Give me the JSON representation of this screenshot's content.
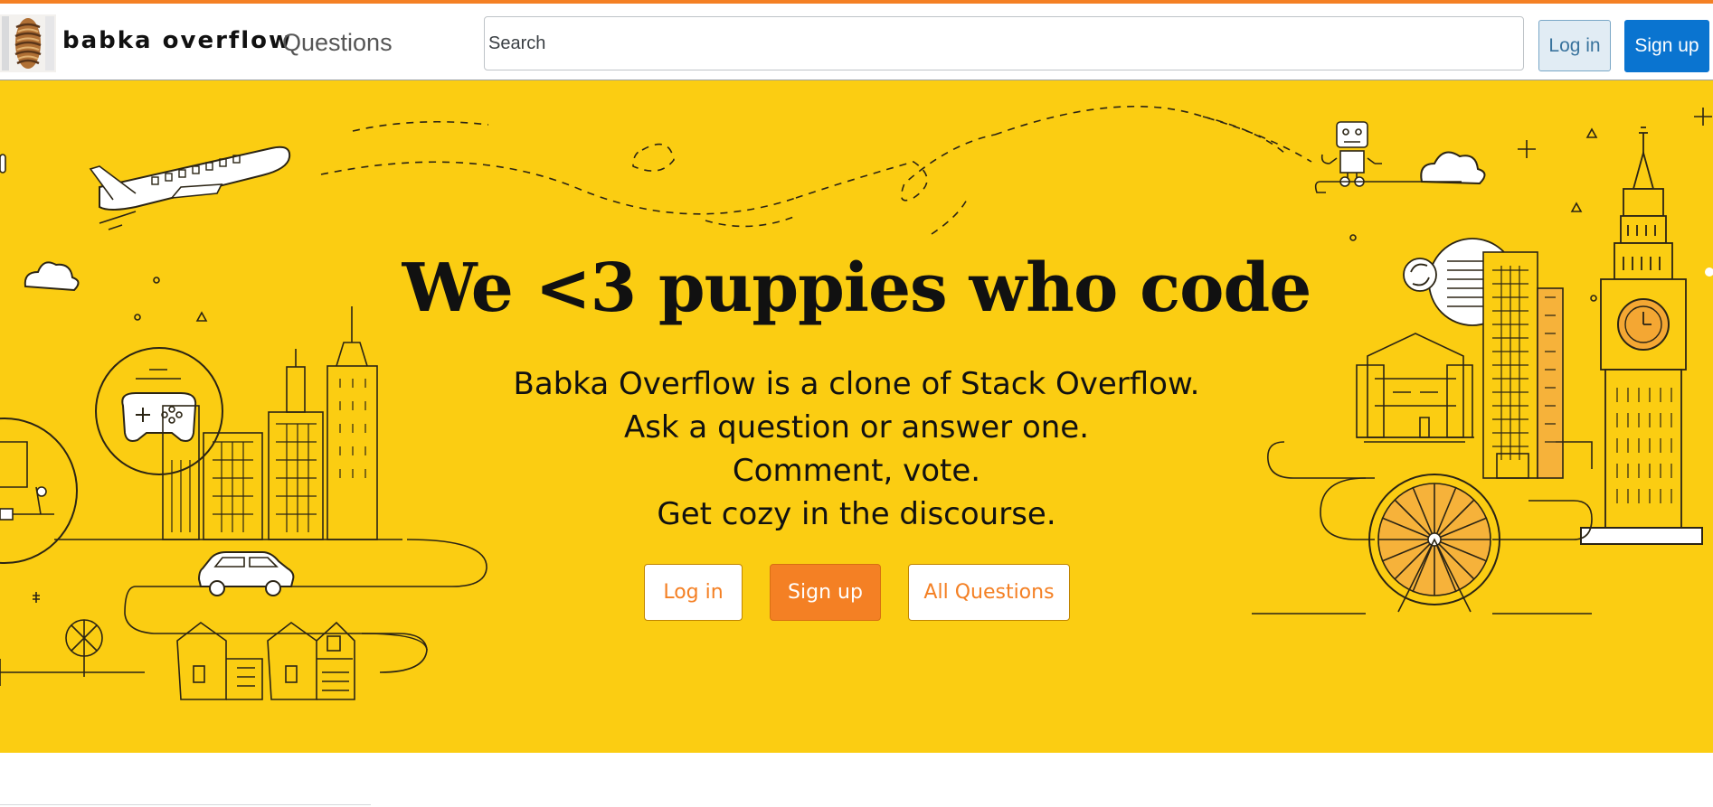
{
  "navbar": {
    "brand": "babka overflow",
    "questions_link": "Questions",
    "search_placeholder": "Search",
    "login_label": "Log in",
    "signup_label": "Sign up"
  },
  "hero": {
    "title": "We <3 puppies who code",
    "lines": [
      "Babka Overflow is a clone of Stack Overflow.",
      "Ask a question or answer one.",
      "Comment, vote.",
      "Get cozy in the discourse."
    ],
    "buttons": {
      "login": "Log in",
      "signup": "Sign up",
      "all_questions": "All Questions"
    }
  },
  "colors": {
    "accent_orange": "#f48024",
    "hero_yellow": "#fbcd12",
    "primary_blue": "#0a74d0",
    "login_bg": "#e1ecf4"
  },
  "icons": [
    "babka-logo",
    "airplane-icon",
    "robot-icon",
    "gamepad-icon",
    "car-icon",
    "big-ben-icon",
    "ferris-wheel-icon",
    "cloud-icon",
    "refresh-icon"
  ]
}
